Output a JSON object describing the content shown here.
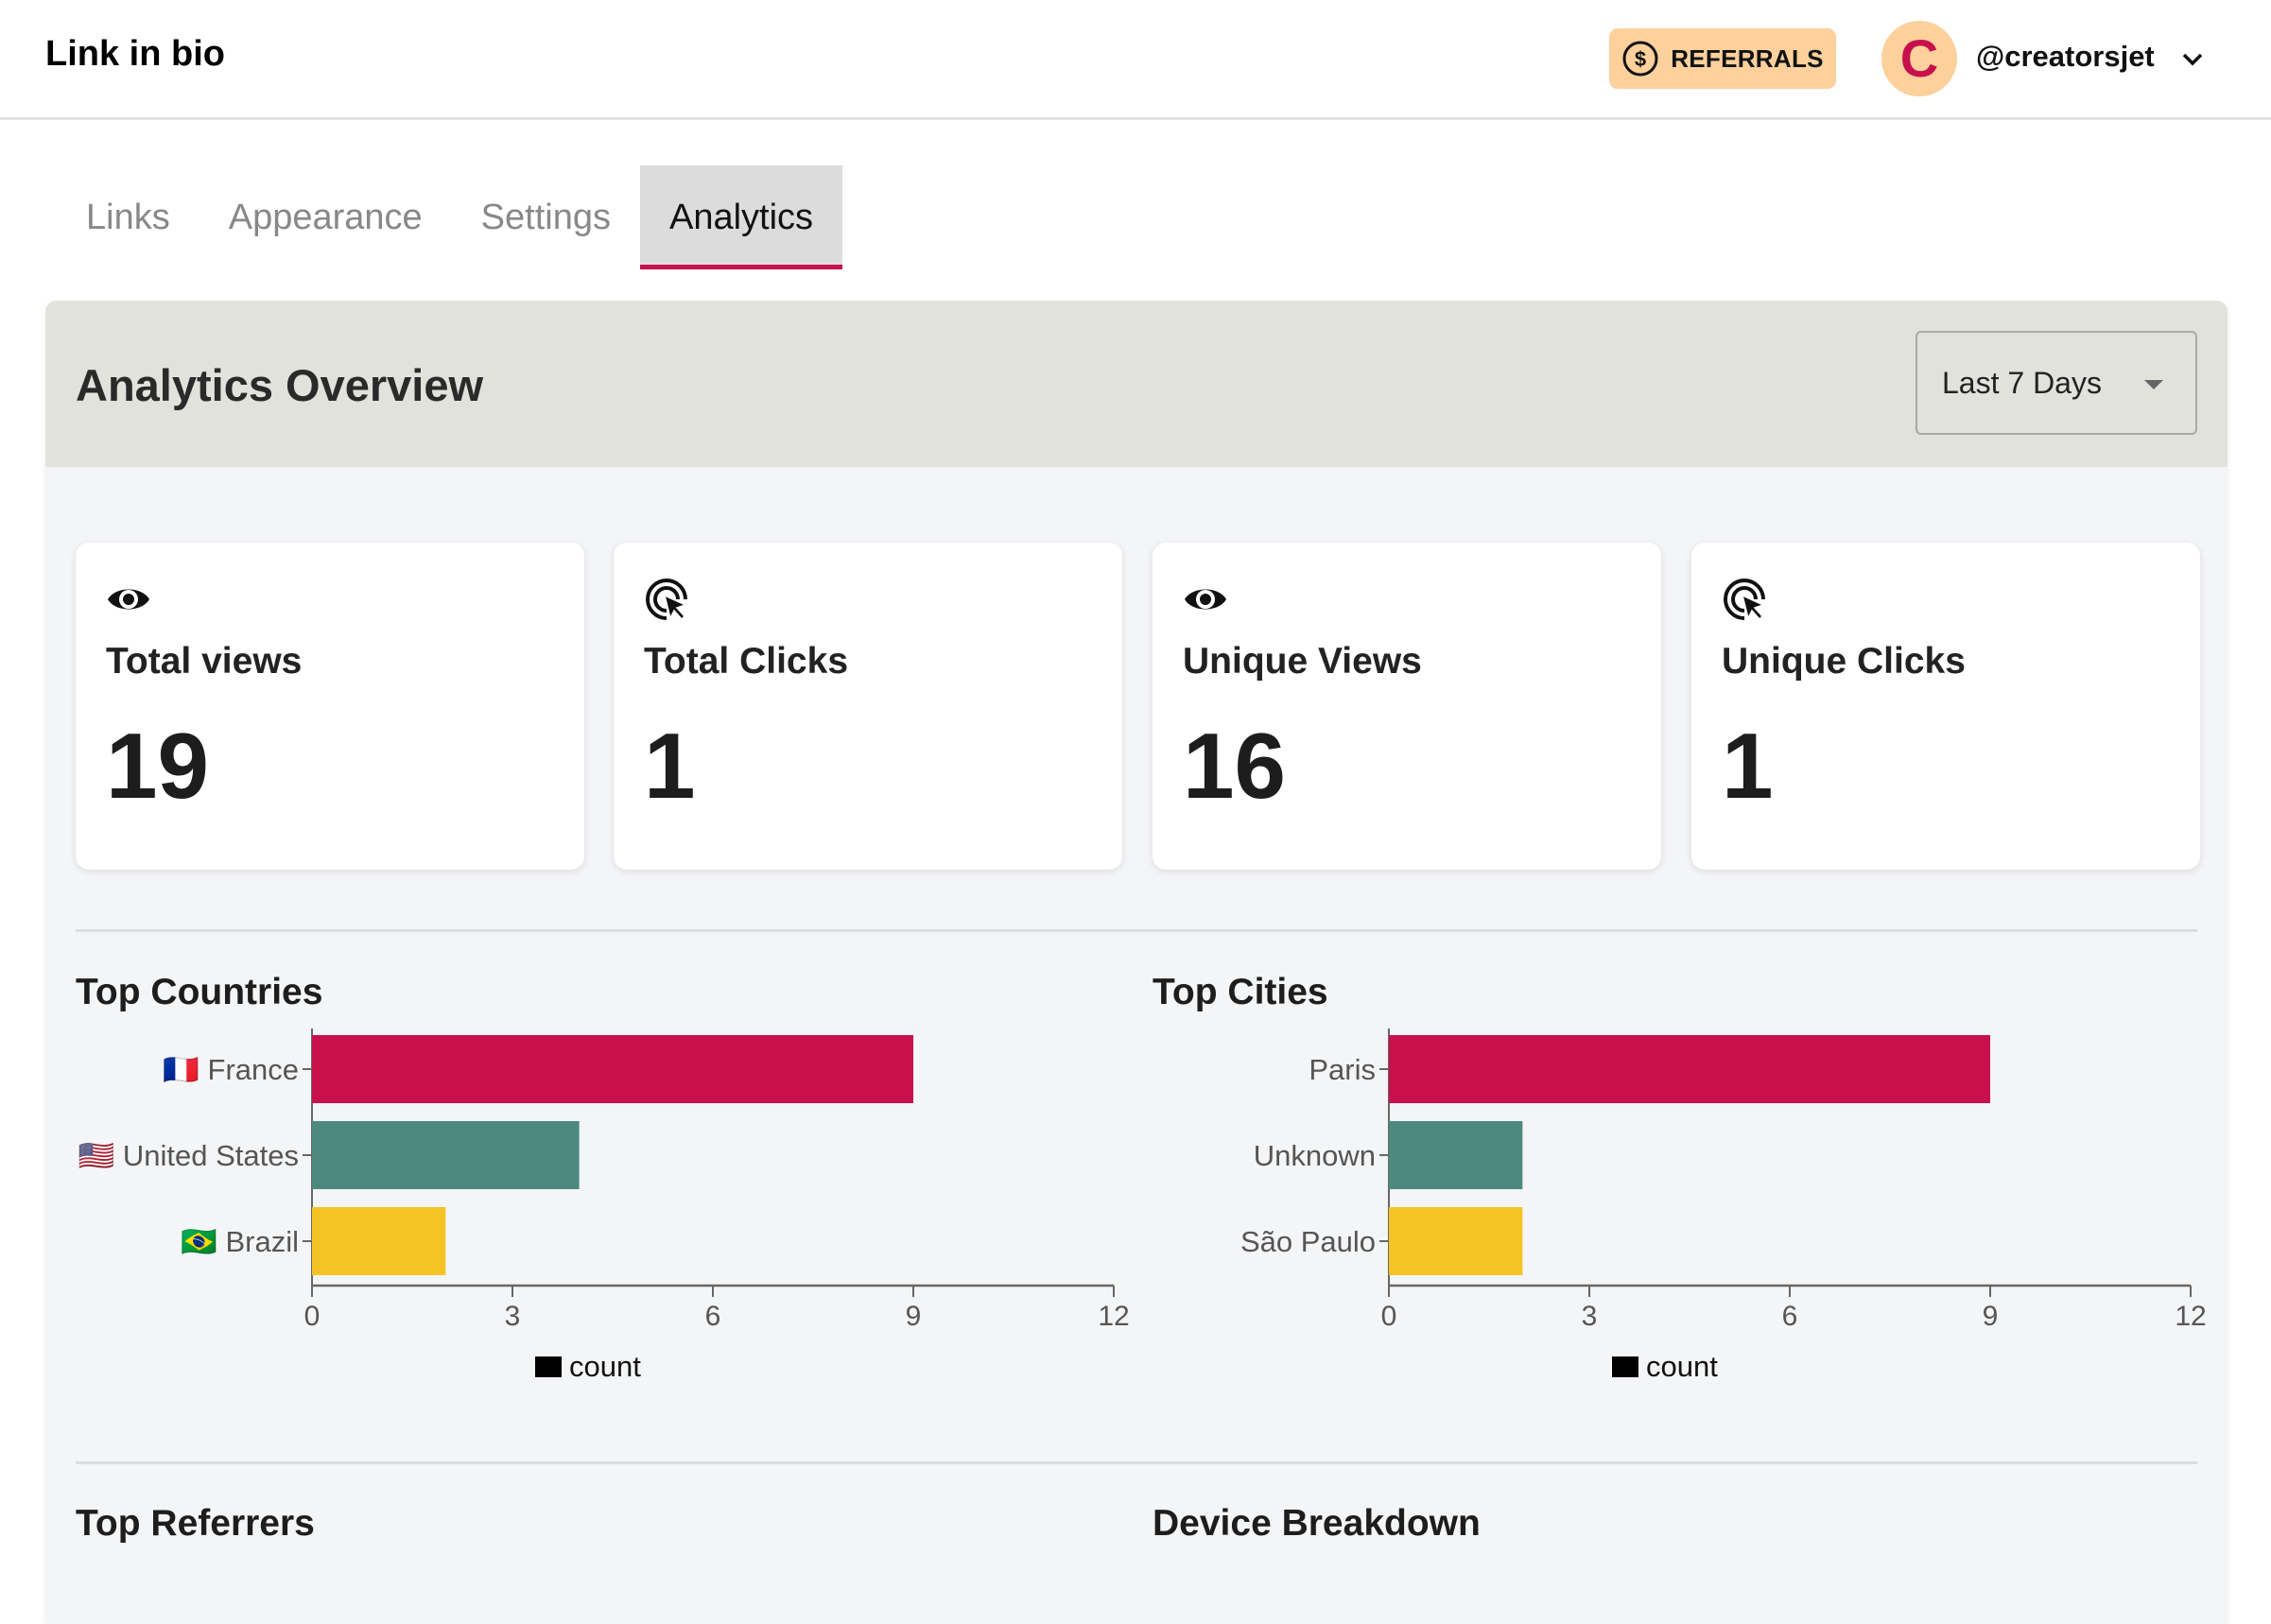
{
  "header": {
    "app_title": "Link in bio",
    "referrals_label": "REFERRALS",
    "referrals_icon": "dollar-circle-icon",
    "avatar_initial": "C",
    "username": "@creatorsjet",
    "user_menu_icon": "chevron-down-icon"
  },
  "tabs": [
    {
      "label": "Links",
      "active": false
    },
    {
      "label": "Appearance",
      "active": false
    },
    {
      "label": "Settings",
      "active": false
    },
    {
      "label": "Analytics",
      "active": true
    }
  ],
  "overview": {
    "title": "Analytics Overview",
    "range": {
      "selected": "Last 7 Days"
    }
  },
  "stats": [
    {
      "icon": "eye-icon",
      "label": "Total views",
      "value": "19"
    },
    {
      "icon": "click-icon",
      "label": "Total Clicks",
      "value": "1"
    },
    {
      "icon": "eye-icon",
      "label": "Unique Views",
      "value": "16"
    },
    {
      "icon": "click-icon",
      "label": "Unique Clicks",
      "value": "1"
    }
  ],
  "sections": {
    "top_countries": "Top Countries",
    "top_cities": "Top Cities",
    "top_referrers": "Top Referrers",
    "device_breakdown": "Device Breakdown"
  },
  "colors": {
    "accent": "#c8104c",
    "bar1": "#c8104c",
    "bar2": "#4c8a7f",
    "bar3": "#f5c325",
    "referral_bg": "#fdd09c"
  },
  "chart_data": [
    {
      "type": "bar",
      "orientation": "horizontal",
      "title": "Top Countries",
      "categories": [
        "🇫🇷 France",
        "🇺🇸 United States",
        "🇧🇷 Brazil"
      ],
      "values": [
        9,
        4,
        2
      ],
      "colors": [
        "#c8104c",
        "#4c8a7f",
        "#f5c325"
      ],
      "xticks": [
        0,
        3,
        6,
        9,
        12
      ],
      "xlim": [
        0,
        12
      ],
      "legend": [
        "count"
      ],
      "legend_position": "bottom"
    },
    {
      "type": "bar",
      "orientation": "horizontal",
      "title": "Top Cities",
      "categories": [
        "Paris",
        "Unknown",
        "São Paulo"
      ],
      "values": [
        9,
        2,
        2
      ],
      "colors": [
        "#c8104c",
        "#4c8a7f",
        "#f5c325"
      ],
      "xticks": [
        0,
        3,
        6,
        9,
        12
      ],
      "xlim": [
        0,
        12
      ],
      "legend": [
        "count"
      ],
      "legend_position": "bottom"
    }
  ]
}
